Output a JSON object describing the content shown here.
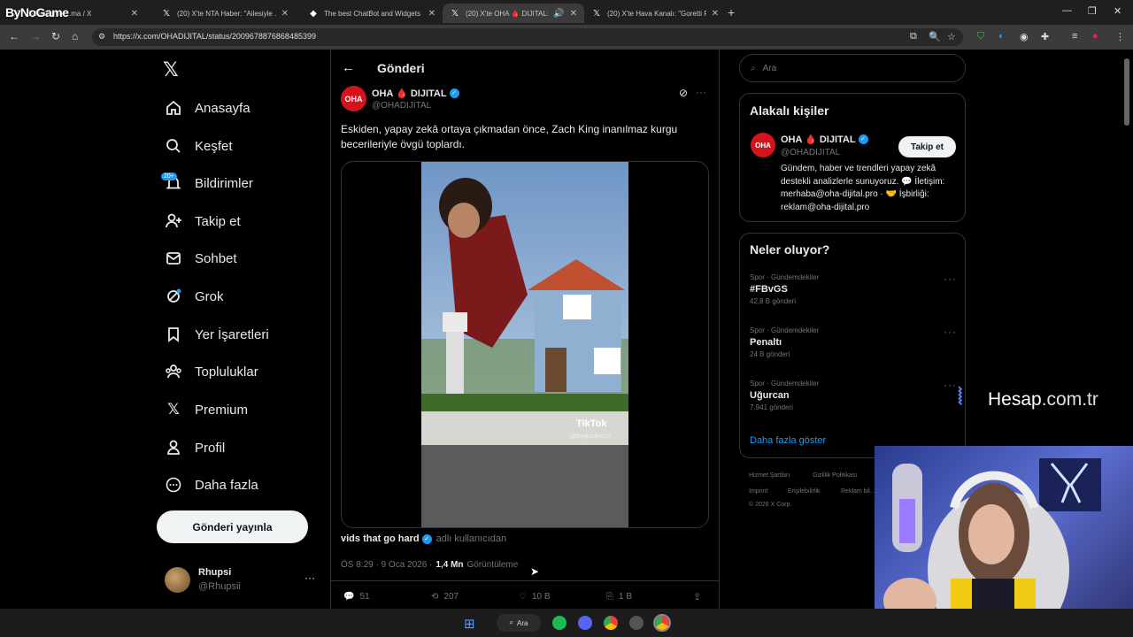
{
  "browser": {
    "tabs": [
      {
        "title": "ByNoGame ...ma / X",
        "icon": "x-icon",
        "active": false
      },
      {
        "title": "(20) X'te NTA Haber: \"Ailesiyle ...",
        "icon": "x-icon",
        "active": false
      },
      {
        "title": "The best ChatBot and Widgets",
        "icon": "diamond-icon",
        "active": false
      },
      {
        "title": "(20) X'te OHA 🩸 DIJITAL: \"...",
        "icon": "x-icon",
        "active": true
      },
      {
        "title": "(20) X'te Hava Kanalı: \"Goretti F...",
        "icon": "x-icon",
        "active": false
      }
    ],
    "url": "https://x.com/OHADIJITAL/status/2009678876868485399"
  },
  "overlay_logo": "ByNoGame",
  "sidebar": {
    "items": [
      {
        "label": "Anasayfa",
        "icon": "home-icon"
      },
      {
        "label": "Keşfet",
        "icon": "search-icon"
      },
      {
        "label": "Bildirimler",
        "icon": "bell-icon",
        "badge": "20+"
      },
      {
        "label": "Takip et",
        "icon": "follow-icon"
      },
      {
        "label": "Sohbet",
        "icon": "mail-icon"
      },
      {
        "label": "Grok",
        "icon": "grok-icon"
      },
      {
        "label": "Yer İşaretleri",
        "icon": "bookmark-icon"
      },
      {
        "label": "Topluluklar",
        "icon": "communities-icon"
      },
      {
        "label": "Premium",
        "icon": "x-icon"
      },
      {
        "label": "Profil",
        "icon": "person-icon"
      },
      {
        "label": "Daha fazla",
        "icon": "more-icon"
      }
    ],
    "post_button": "Gönderi yayınla",
    "account": {
      "name": "Rhupsi",
      "handle": "@Rhupsii"
    }
  },
  "post": {
    "header_title": "Gönderi",
    "author_name": "OHA 🩸 DIJITAL",
    "author_handle": "@OHADIJITAL",
    "avatar_text": "OHA",
    "text": "Eskiden, yapay zekâ ortaya çıkmadan önce, Zach King inanılmaz kurgu becerileriyle övgü toplardı.",
    "video_watermark": "TikTok",
    "video_user": "@tomjackson2",
    "source_name": "vids that go hard",
    "source_suffix": "adlı kullanıcıdan",
    "time": "ÖS 8:29 · 9 Oca 2026 ·",
    "views": "1,4 Mn",
    "views_label": "Görüntüleme",
    "stats": {
      "replies": "51",
      "reposts": "207",
      "likes": "10 B",
      "bookmarks": "1 B"
    }
  },
  "right": {
    "search_placeholder": "Ara",
    "related_title": "Alakalı kişiler",
    "related": {
      "name": "OHA 🩸 DIJITAL",
      "handle": "@OHADIJITAL",
      "follow": "Takip et",
      "bio": "Gündem, haber ve trendleri yapay zekâ destekli analizlerle sunuyoruz. 💬 İletişim: merhaba@oha-dijital.pro · 🤝 İşbirliği: reklam@oha-dijital.pro"
    },
    "trends_title": "Neler oluyor?",
    "trends": [
      {
        "category": "Spor · Gündemdekiler",
        "name": "#FBvGS",
        "count": "42,8 B gönderi"
      },
      {
        "category": "Spor · Gündemdekiler",
        "name": "Penaltı",
        "count": "24 B gönderi"
      },
      {
        "category": "Spor · Gündemdekiler",
        "name": "Uğurcan",
        "count": "7.941 gönderi"
      }
    ],
    "show_more": "Daha fazla göster",
    "footer": [
      "Hizmet Şartları",
      "Gizlilik Politikası",
      "Imprint",
      "Erişilebilirlik",
      "Reklam bil...",
      "© 2026 X Corp."
    ]
  },
  "sponsor": {
    "text": "Hesap",
    "suffix": ".com.tr"
  },
  "taskbar": {
    "search": "Ara"
  },
  "colors": {
    "accent": "#1d9bf0",
    "brand_red": "#d4131d",
    "bg": "#000000"
  }
}
